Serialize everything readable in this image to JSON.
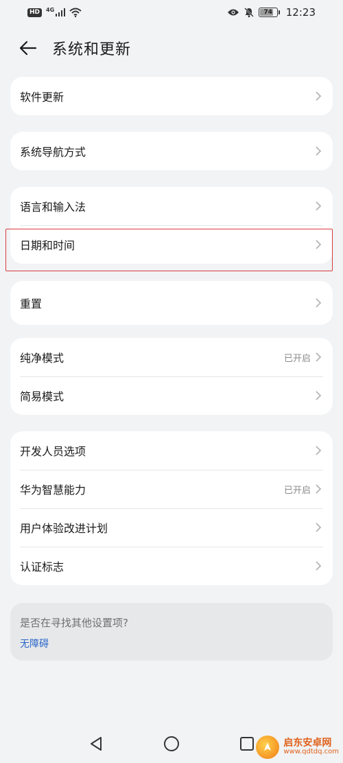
{
  "status_bar": {
    "hd": "HD",
    "network": "4G",
    "battery_level": 74,
    "battery_text": "74",
    "time": "12:23",
    "icons": [
      "signal-icon",
      "wifi-icon",
      "eye-icon",
      "bell-off-icon",
      "battery-icon"
    ]
  },
  "header": {
    "title": "系统和更新",
    "back_icon": "back-arrow-icon"
  },
  "groups": [
    {
      "items": [
        {
          "label": "软件更新",
          "status": ""
        }
      ]
    },
    {
      "items": [
        {
          "label": "系统导航方式",
          "status": ""
        }
      ]
    },
    {
      "items": [
        {
          "label": "语言和输入法",
          "status": ""
        },
        {
          "label": "日期和时间",
          "status": ""
        }
      ]
    },
    {
      "items": [
        {
          "label": "重置",
          "status": ""
        }
      ]
    },
    {
      "items": [
        {
          "label": "纯净模式",
          "status": "已开启"
        },
        {
          "label": "简易模式",
          "status": ""
        }
      ]
    },
    {
      "items": [
        {
          "label": "开发人员选项",
          "status": ""
        },
        {
          "label": "华为智慧能力",
          "status": "已开启"
        },
        {
          "label": "用户体验改进计划",
          "status": ""
        },
        {
          "label": "认证标志",
          "status": ""
        }
      ]
    }
  ],
  "search_card": {
    "question": "是否在寻找其他设置项?",
    "link": "无障碍"
  },
  "watermark": {
    "name": "启东安卓网",
    "url": "www.qdtdq.com"
  },
  "colors": {
    "background": "#f1f3f5",
    "card": "#ffffff",
    "highlight": "#d93a3a",
    "link": "#2a66c8",
    "secondary_text": "#8a8a8a"
  }
}
